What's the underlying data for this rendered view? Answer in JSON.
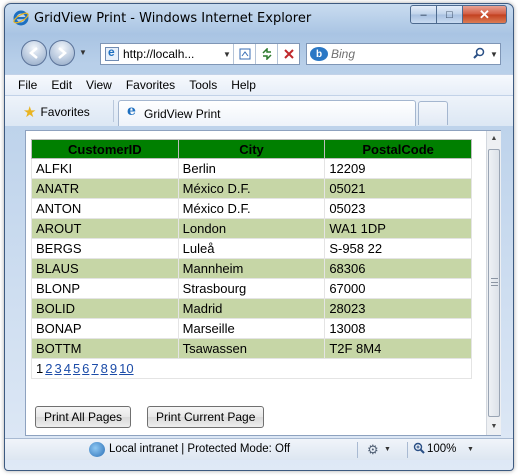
{
  "window": {
    "title": "GridView Print - Windows Internet Explorer",
    "minimize_glyph": "–",
    "maximize_glyph": "□",
    "close_glyph": "✕"
  },
  "nav": {
    "address": "http://localh...",
    "search_placeholder": "Bing",
    "search_engine_glyph": "b"
  },
  "menu": [
    "File",
    "Edit",
    "View",
    "Favorites",
    "Tools",
    "Help"
  ],
  "tabs": {
    "favorites_label": "Favorites",
    "active_tab": "GridView Print"
  },
  "grid": {
    "header_color": "#007f00",
    "alt_row_color": "#c6d6a6",
    "columns": [
      "CustomerID",
      "City",
      "PostalCode"
    ],
    "rows": [
      [
        "ALFKI",
        "Berlin",
        "12209"
      ],
      [
        "ANATR",
        "México D.F.",
        "05021"
      ],
      [
        "ANTON",
        "México D.F.",
        "05023"
      ],
      [
        "AROUT",
        "London",
        "WA1 1DP"
      ],
      [
        "BERGS",
        "Luleå",
        "S-958 22"
      ],
      [
        "BLAUS",
        "Mannheim",
        "68306"
      ],
      [
        "BLONP",
        "Strasbourg",
        "67000"
      ],
      [
        "BOLID",
        "Madrid",
        "28023"
      ],
      [
        "BONAP",
        "Marseille",
        "13008"
      ],
      [
        "BOTTM",
        "Tsawassen",
        "T2F 8M4"
      ]
    ],
    "pager": {
      "current": "1",
      "pages": [
        "2",
        "3",
        "4",
        "5",
        "6",
        "7",
        "8",
        "9",
        "10"
      ]
    }
  },
  "buttons": {
    "print_all": "Print All Pages",
    "print_current": "Print Current Page"
  },
  "status": {
    "zone": "Local intranet | Protected Mode: Off",
    "zoom": "100%"
  }
}
